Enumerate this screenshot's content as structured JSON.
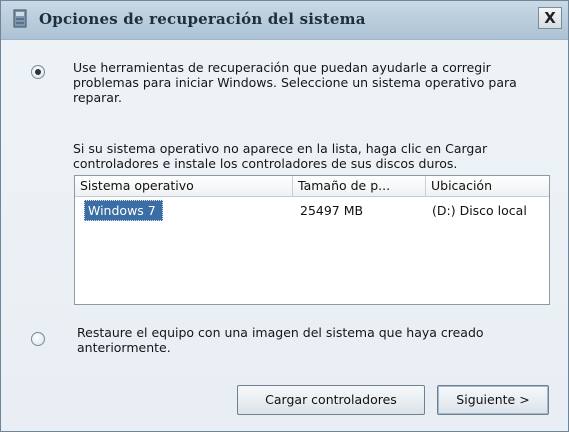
{
  "window": {
    "title": "Opciones de recuperación del sistema",
    "close_label": "X"
  },
  "option_tools": {
    "selected": true,
    "text": "Use herramientas de recuperación que puedan ayudarle a corregir problemas para iniciar Windows. Seleccione un sistema operativo para reparar."
  },
  "hint": {
    "text": "Si su sistema operativo no aparece en la lista, haga clic en Cargar controladores e instale los controladores de sus discos duros."
  },
  "os_list": {
    "columns": [
      "Sistema operativo",
      "Tamaño de p...",
      "Ubicación"
    ],
    "rows": [
      {
        "os": "Windows 7",
        "size": "25497 MB",
        "location": "(D:) Disco local",
        "selected": true
      }
    ]
  },
  "option_image": {
    "selected": false,
    "text": "Restaure el equipo con una imagen del sistema que haya creado anteriormente."
  },
  "buttons": {
    "load_drivers": "Cargar controladores",
    "next": "Siguiente >"
  },
  "colors": {
    "selection": "#3a6ea5",
    "titlebar": "#b8ccdc"
  }
}
